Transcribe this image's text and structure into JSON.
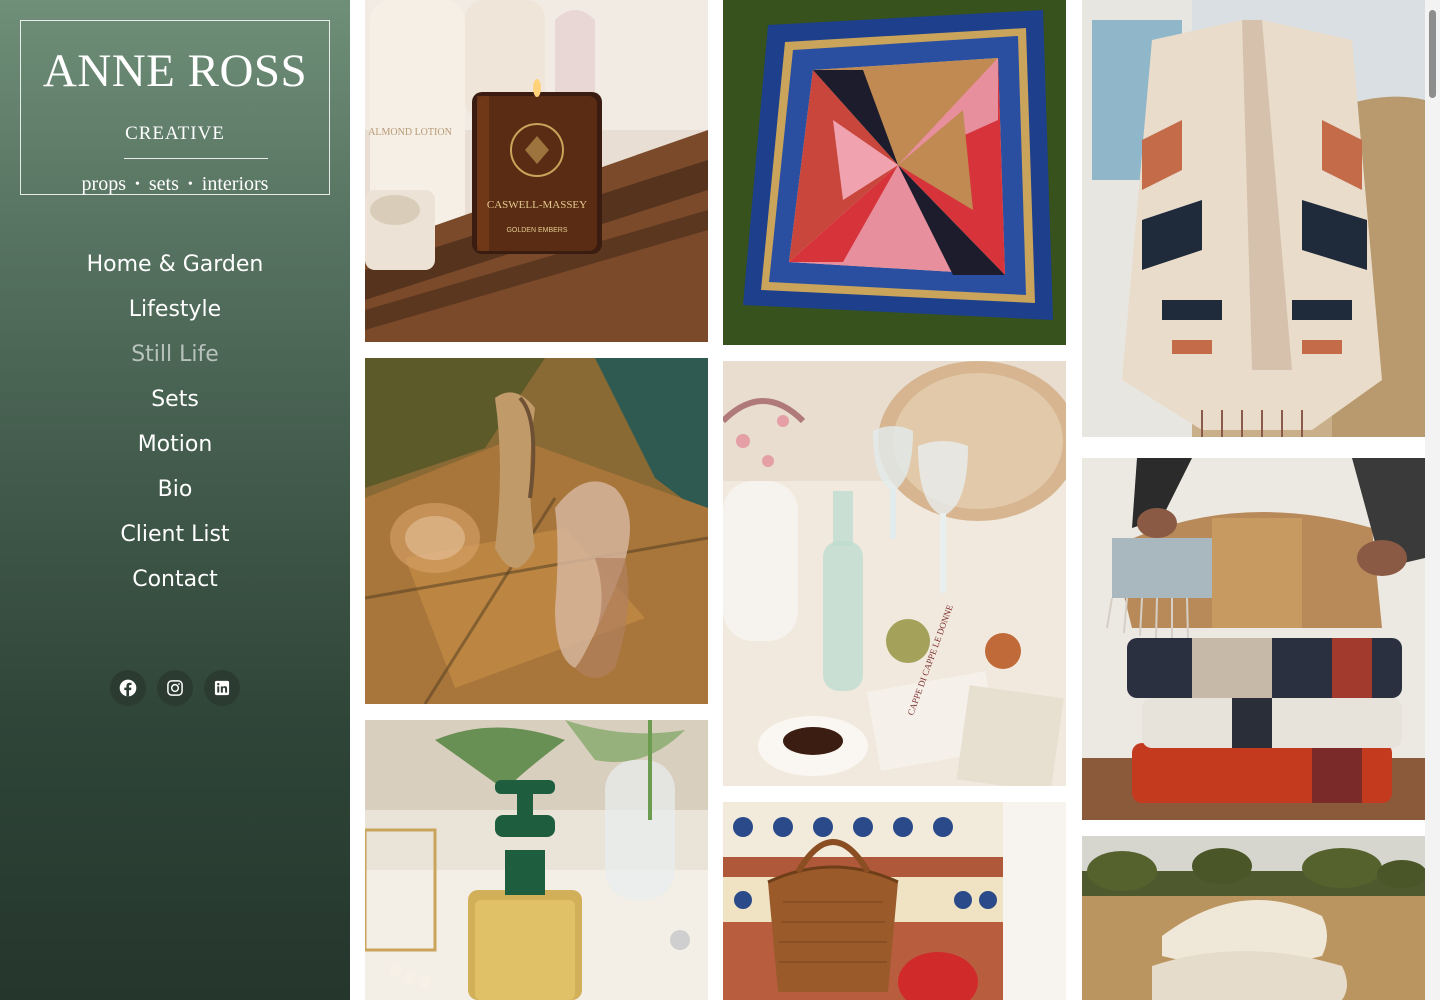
{
  "brand": {
    "name": "ANNE ROSS",
    "subtitle": "CREATIVE",
    "tagline_words": [
      "props",
      "sets",
      "interiors"
    ],
    "separator": "•"
  },
  "nav": {
    "items": [
      {
        "label": "Home & Garden",
        "active": false
      },
      {
        "label": "Lifestyle",
        "active": false
      },
      {
        "label": "Still Life",
        "active": true
      },
      {
        "label": "Sets",
        "active": false
      },
      {
        "label": "Motion",
        "active": false
      },
      {
        "label": "Bio",
        "active": false
      },
      {
        "label": "Client List",
        "active": false
      },
      {
        "label": "Contact",
        "active": false
      }
    ]
  },
  "social": [
    {
      "icon": "facebook-icon"
    },
    {
      "icon": "instagram-icon"
    },
    {
      "icon": "linkedin-icon"
    }
  ],
  "gallery": {
    "columns": [
      [
        {
          "subject": "candle-bath-tray",
          "product_label": "CASWELL-MASSEY",
          "product_sublabel": "GOLDEN EMBERS",
          "bottle_label": "ALMOND LOTION"
        },
        {
          "subject": "clear-heel-sandals"
        },
        {
          "subject": "perfume-bottle"
        }
      ],
      [
        {
          "subject": "silk-scarf-on-grass"
        },
        {
          "subject": "table-with-wine-glasses",
          "book_label": "CAPPE DI CAPPE LE DONNE"
        },
        {
          "subject": "woven-bag-on-tiled-steps"
        }
      ],
      [
        {
          "subject": "fringed-cardigan"
        },
        {
          "subject": "folded-blankets"
        },
        {
          "subject": "pillows-in-field"
        }
      ]
    ]
  },
  "colors": {
    "sidebar_top": "#6f8f78",
    "sidebar_bottom": "#25362d",
    "nav_text": "#ffffff",
    "nav_active": "rgba(255,255,255,0.6)",
    "social_bg": "#2b3b31"
  }
}
